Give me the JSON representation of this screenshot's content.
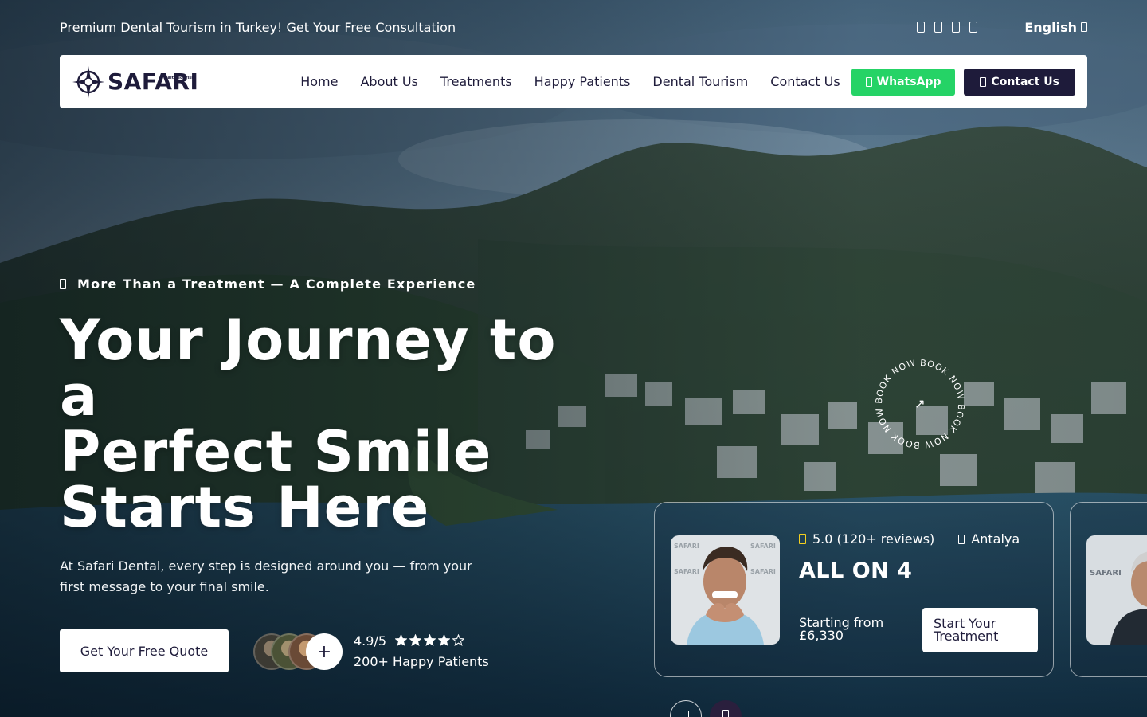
{
  "topbar": {
    "promo_text": "Premium Dental Tourism in Turkey!",
    "promo_link": "Get Your Free Consultation",
    "language": "English"
  },
  "social_icons": [
    "facebook-icon",
    "instagram-icon",
    "youtube-icon",
    "tiktok-icon"
  ],
  "nav": {
    "logo_text": "SAFARI",
    "logo_subtext": "Health Tourism",
    "links": [
      "Home",
      "About Us",
      "Treatments",
      "Happy Patients",
      "Dental Tourism",
      "Contact Us"
    ],
    "whatsapp_label": "WhatsApp",
    "contact_label": "Contact Us"
  },
  "hero": {
    "eyebrow": "More Than a Treatment — A Complete Experience",
    "title_lines": [
      "Your Journey to",
      "a",
      "Perfect Smile",
      "Starts Here"
    ],
    "description": "At Safari Dental, every step is designed around you — from your first message to your final smile.",
    "cta_label": "Get Your Free Quote",
    "rating": "4.9/5",
    "stars_filled": 4,
    "stars_total": 5,
    "happy_patients": "200+ Happy Patients",
    "avatar_plus": "+"
  },
  "badge": {
    "text": "BOOK NOW",
    "arrow": "↗"
  },
  "treatment_card": {
    "rating": "5.0 (120+ reviews)",
    "location": "Antalya",
    "title": "ALL ON 4",
    "price_label": "Starting from £6,330",
    "button_label": "Start Your Treatment",
    "photo_watermark": "SAFARI"
  },
  "colors": {
    "brand_dark": "#1e1b3a",
    "whatsapp": "#25d366",
    "star_yellow": "#f5d020"
  }
}
